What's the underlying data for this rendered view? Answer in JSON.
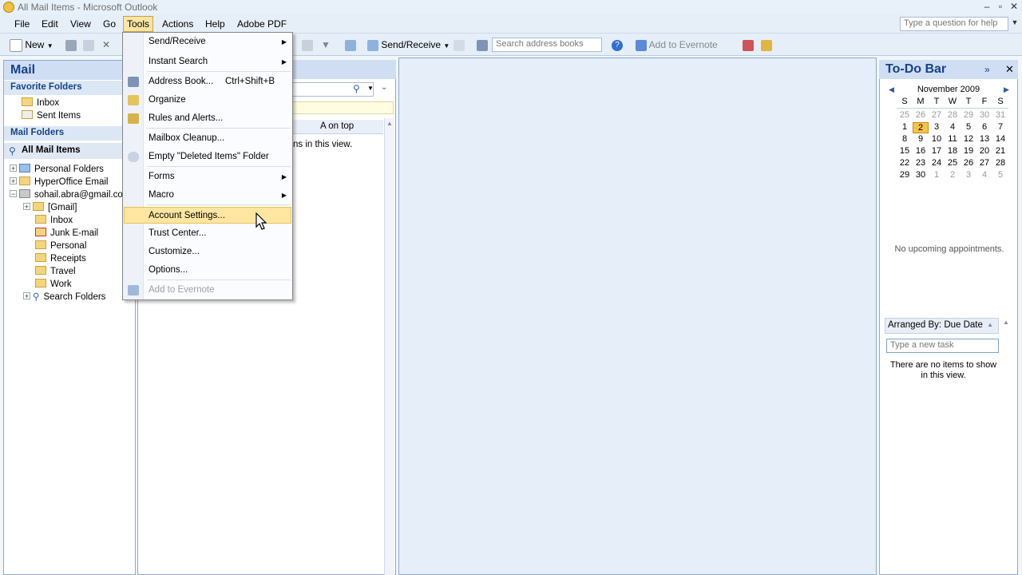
{
  "window": {
    "title": "All Mail Items - Microsoft Outlook"
  },
  "menubar": {
    "items": [
      "File",
      "Edit",
      "View",
      "Go",
      "Tools",
      "Actions",
      "Help",
      "Adobe PDF"
    ],
    "ask_placeholder": "Type a question for help"
  },
  "toolbar": {
    "new_label": "New",
    "send_receive_label": "Send/Receive",
    "search_address_books": "Search address books",
    "add_to_evernote": "Add to Evernote"
  },
  "nav": {
    "title": "Mail",
    "favorite_folders_label": "Favorite Folders",
    "favorites": [
      "Inbox",
      "Sent Items"
    ],
    "mail_folders_label": "Mail Folders",
    "all_mail_items": "All Mail Items",
    "tree": {
      "personal_folders": "Personal Folders",
      "hyperoffice": "HyperOffice Email",
      "account": "sohail.abra@gmail.com",
      "gmail": "[Gmail]",
      "inbox": "Inbox",
      "junk": "Junk E-mail",
      "personal": "Personal",
      "receipts": "Receipts",
      "travel": "Travel",
      "work": "Work",
      "search_folders": "Search Folders"
    }
  },
  "list": {
    "column_a_on_top": "A on top",
    "empty_fragment": "ns in this view."
  },
  "tools_menu": {
    "send_receive": "Send/Receive",
    "instant_search": "Instant Search",
    "address_book": "Address Book...",
    "address_book_shortcut": "Ctrl+Shift+B",
    "organize": "Organize",
    "rules_alerts": "Rules and Alerts...",
    "mailbox_cleanup": "Mailbox Cleanup...",
    "empty_deleted": "Empty \"Deleted Items\" Folder",
    "forms": "Forms",
    "macro": "Macro",
    "account_settings": "Account Settings...",
    "trust_center": "Trust Center...",
    "customize": "Customize...",
    "options": "Options...",
    "add_to_evernote": "Add to Evernote"
  },
  "todo": {
    "title": "To-Do Bar",
    "month": "November 2009",
    "weekdays": [
      "S",
      "M",
      "T",
      "W",
      "T",
      "F",
      "S"
    ],
    "weeks": [
      [
        "25",
        "26",
        "27",
        "28",
        "29",
        "30",
        "31"
      ],
      [
        "1",
        "2",
        "3",
        "4",
        "5",
        "6",
        "7"
      ],
      [
        "8",
        "9",
        "10",
        "11",
        "12",
        "13",
        "14"
      ],
      [
        "15",
        "16",
        "17",
        "18",
        "19",
        "20",
        "21"
      ],
      [
        "22",
        "23",
        "24",
        "25",
        "26",
        "27",
        "28"
      ],
      [
        "29",
        "30",
        "1",
        "2",
        "3",
        "4",
        "5"
      ]
    ],
    "today": "2",
    "no_appointments": "No upcoming appointments.",
    "arranged_by": "Arranged By: Due Date",
    "new_task_placeholder": "Type a new task",
    "no_items": "There are no items to show in this view."
  },
  "colors": {
    "accent": "#15428b",
    "highlight": "#ffe6a0",
    "header": "#cfdef3"
  }
}
